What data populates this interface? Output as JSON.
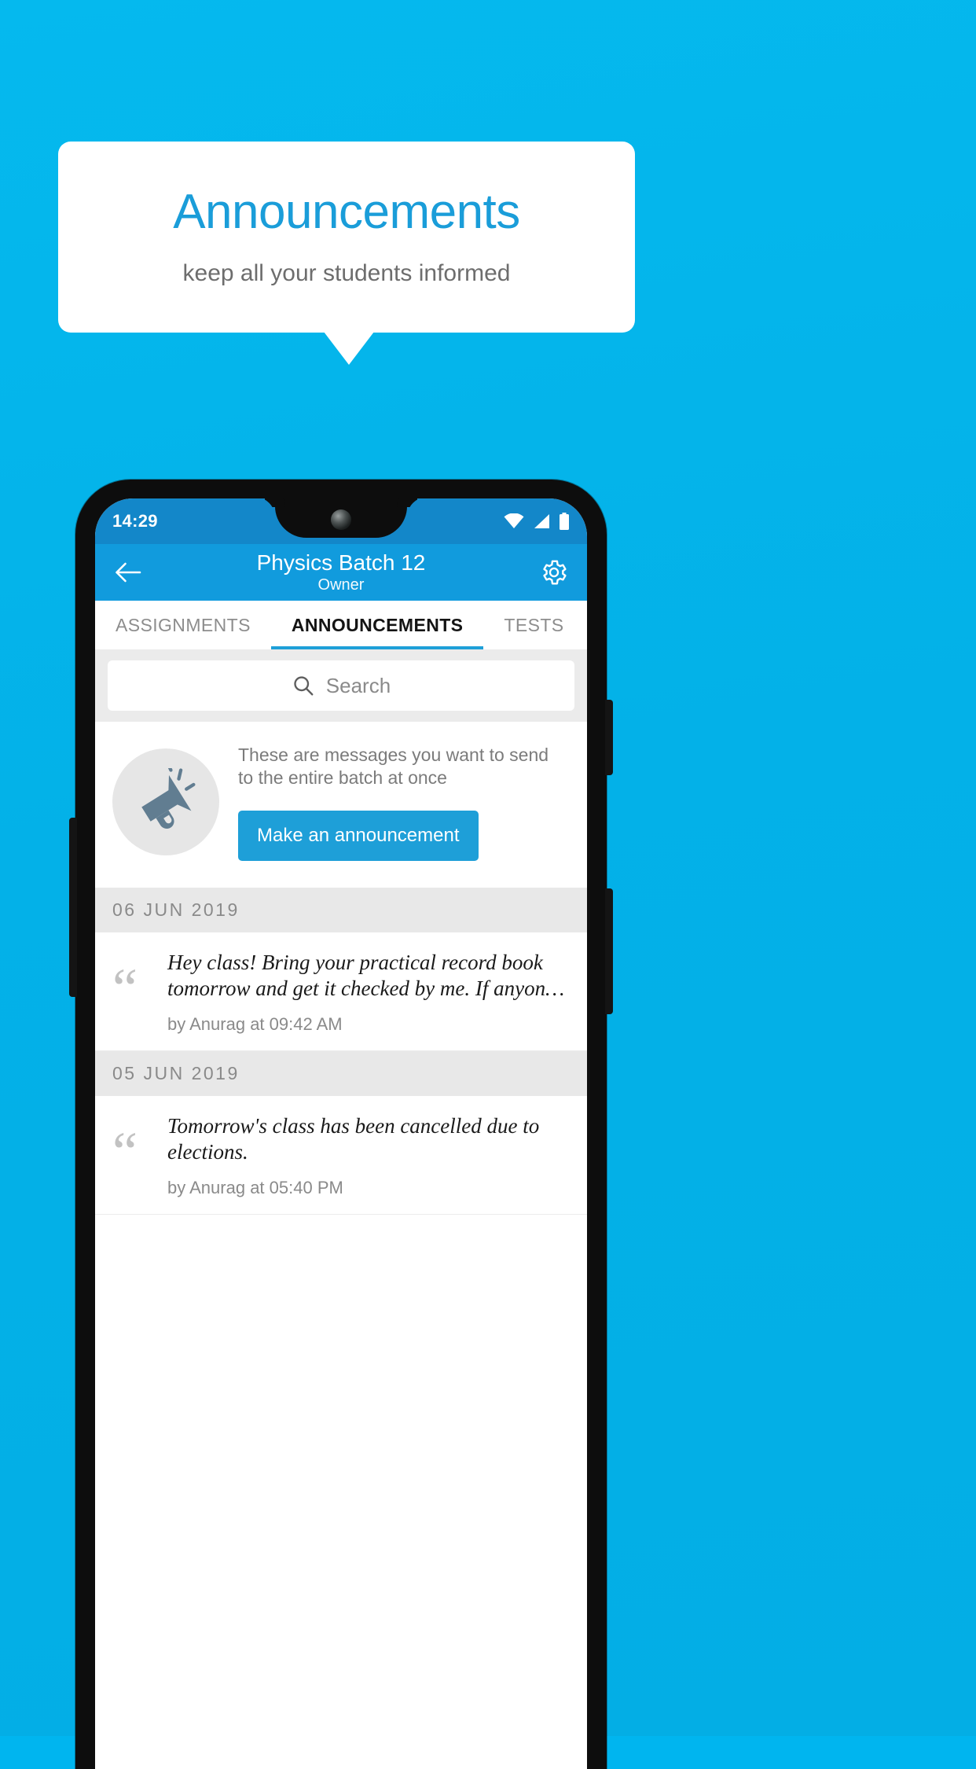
{
  "promo": {
    "title": "Announcements",
    "subtitle": "keep all your students informed",
    "background_color": "#03b1e8",
    "title_color": "#1a9dd9",
    "card_color": "#ffffff"
  },
  "phone": {
    "statusbar": {
      "time": "14:29",
      "icons": [
        "wifi-icon",
        "signal-icon",
        "battery-icon"
      ],
      "background_color": "#1387c9"
    },
    "appbar": {
      "back_icon": "arrow-left-icon",
      "title": "Physics Batch 12",
      "subtitle": "Owner",
      "settings_icon": "gear-icon",
      "background_color": "#119bdd"
    },
    "tabs": {
      "items": [
        {
          "label": "ASSIGNMENTS",
          "active": false
        },
        {
          "label": "ANNOUNCEMENTS",
          "active": true
        },
        {
          "label": "TESTS",
          "active": false
        },
        {
          "label": "\u0001",
          "active": false
        }
      ],
      "indicator_color": "#1e9fd8"
    },
    "search": {
      "icon": "search-icon",
      "placeholder": "Search",
      "value": ""
    },
    "promo_card": {
      "icon": "megaphone-icon",
      "text": "These are messages you want to send to the entire batch at once",
      "button_label": "Make an announcement",
      "button_color": "#1e9fd8"
    },
    "groups": [
      {
        "date": "06  JUN  2019",
        "items": [
          {
            "quote_icon": "quote-icon",
            "text": "Hey class! Bring your practical record book tomorrow and get it checked by me. If anyon…",
            "meta": "by Anurag at 09:42 AM"
          }
        ]
      },
      {
        "date": "05  JUN  2019",
        "items": [
          {
            "quote_icon": "quote-icon",
            "text": "Tomorrow's class has been cancelled due to elections.",
            "meta": "by Anurag at 05:40 PM"
          }
        ]
      }
    ]
  }
}
